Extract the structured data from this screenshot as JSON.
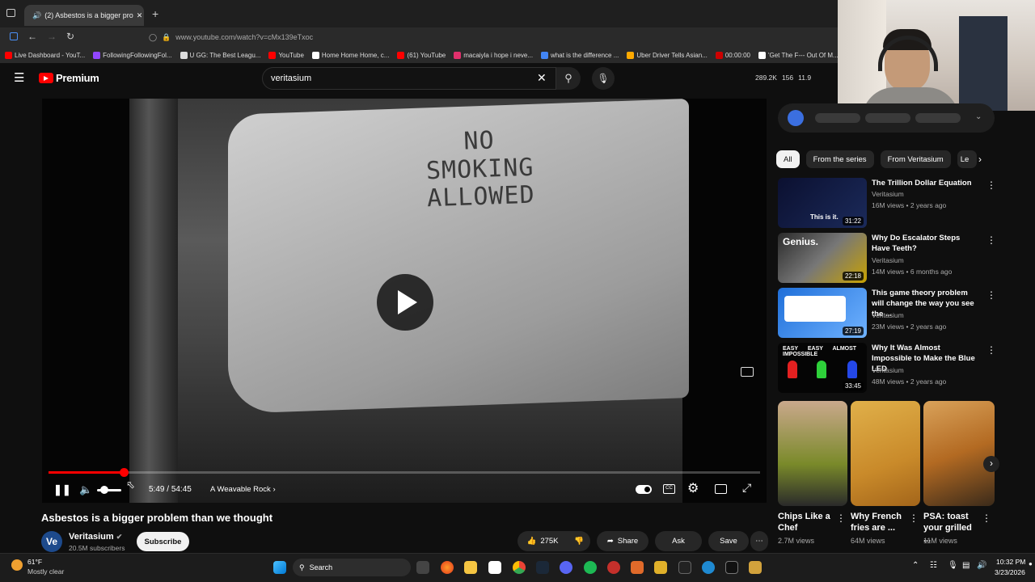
{
  "browser": {
    "tab_title": "(2) Asbestos is a bigger pro",
    "url": "www.youtube.com/watch?v=cMx139eTxoc",
    "bookmarks": [
      "Live Dashboard - YouT...",
      "FollowingFollowingFol...",
      "U GG: The Best Leagu...",
      "YouTube",
      "Home Home Home, c...",
      "(61) YouTube",
      "macaiyla i hope i neve...",
      "what is the difference ...",
      "Uber Driver Tells Asian...",
      "00:00:00",
      "'Get The F--- Out Of M..."
    ]
  },
  "header": {
    "logo_label": "Premium",
    "search_value": "veritasium",
    "stats": [
      "289.2K",
      "156",
      "11.9"
    ]
  },
  "video": {
    "sign_text": [
      "NO",
      "SMOKING",
      "ALLOWED"
    ],
    "current_time": "5:49",
    "separator": "/",
    "duration": "54:45",
    "chapter": "A Weavable Rock",
    "progress_fraction": 0.106,
    "title": "Asbestos is a bigger problem than we thought"
  },
  "channel": {
    "avatar_text": "Ve",
    "name": "Veritasium",
    "subscribers": "20.5M subscribers",
    "subscribe_label": "Subscribe"
  },
  "actions": {
    "likes": "275K",
    "share": "Share",
    "ask": "Ask",
    "save": "Save"
  },
  "sidebar": {
    "chips": [
      "All",
      "From the series",
      "From Veritasium",
      "Le"
    ],
    "recommendations": [
      {
        "title": "The Trillion Dollar Equation",
        "channel": "Veritasium",
        "meta": "16M views • 2 years ago",
        "duration": "31:22",
        "thumb_text": "This is it."
      },
      {
        "title": "Why Do Escalator Steps Have Teeth?",
        "channel": "Veritasium",
        "meta": "14M views • 6 months ago",
        "duration": "22:18",
        "thumb_text": "Genius."
      },
      {
        "title": "This game theory problem will change the way you see the ...",
        "channel": "Veritasium",
        "meta": "23M views • 2 years ago",
        "duration": "27:19",
        "thumb_text": ""
      },
      {
        "title": "Why It Was Almost Impossible to Make the Blue LED",
        "channel": "Veritasium",
        "meta": "48M views • 2 years ago",
        "duration": "33:45",
        "thumb_text": "EASY EASY ALMOST IMPOSSIBLE"
      }
    ],
    "shorts": [
      {
        "title": "Chips Like a Chef",
        "views": "2.7M views"
      },
      {
        "title": "Why French fries are ...",
        "views": "64M views"
      },
      {
        "title": "PSA: toast your grilled ...",
        "views": "11M views"
      }
    ]
  },
  "taskbar": {
    "weather_temp": "61°F",
    "weather_desc": "Mostly clear",
    "search_label": "Search",
    "time": "10:32 PM",
    "date": "3/23/2026"
  },
  "colors": {
    "accent": "#ff0000",
    "bg": "#0f0f0f",
    "chip": "#272727"
  }
}
